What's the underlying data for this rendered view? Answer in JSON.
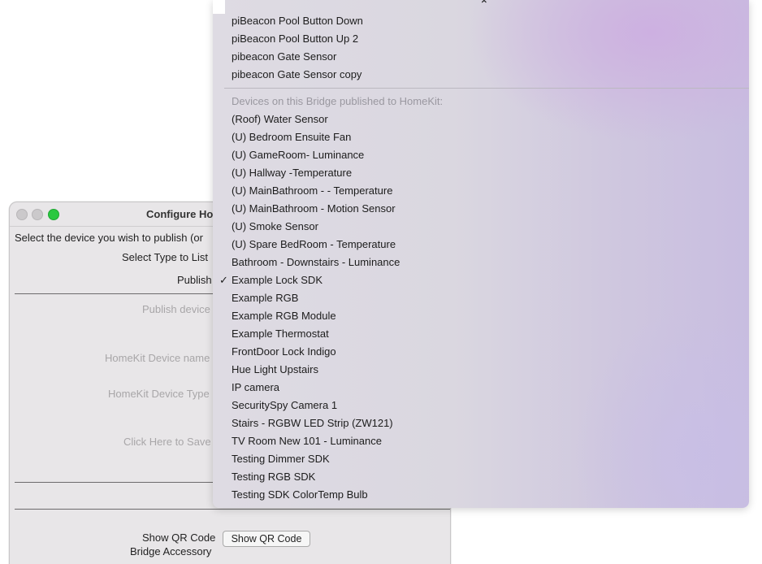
{
  "window": {
    "title": "Configure Ho",
    "instruction": "Select the device you wish to publish (or",
    "select_type_label": "Select Type to List",
    "publish_label": "Publish",
    "publish_device_label": "Publish device",
    "homekit_device_name_label": "HomeKit Device name",
    "homekit_device_type_label": "HomeKit Device Type",
    "click_save_label": "Click Here to Save",
    "show_qr_label": "Show QR Code",
    "show_qr_button": "Show QR Code",
    "bridge_accessory_label": "Bridge Accessory"
  },
  "menu": {
    "scroll_up_glyph": "⌃",
    "items_top": [
      "piBeacon Pool Button Down",
      "piBeacon Pool Button Up 2",
      "pibeacon Gate Sensor",
      "pibeacon Gate Sensor copy"
    ],
    "section_header": "Devices  on this Bridge published to HomeKit:",
    "items_bridge": [
      "(Roof) Water Sensor",
      "(U) Bedroom Ensuite Fan",
      "(U) GameRoom-  Luminance",
      "(U) Hallway -Temperature",
      "(U) MainBathroom - - Temperature",
      "(U) MainBathroom - Motion Sensor",
      "(U) Smoke Sensor",
      "(U) Spare BedRoom -  Temperature",
      "Bathroom - Downstairs - Luminance",
      "Example Lock SDK",
      "Example RGB",
      "Example RGB Module",
      "Example Thermostat",
      "FrontDoor Lock Indigo",
      "Hue Light Upstairs",
      "IP camera",
      "SecuritySpy Camera 1",
      "Stairs - RGBW LED Strip (ZW121)",
      "TV Room New 101 - Luminance",
      "Testing Dimmer SDK",
      "Testing RGB SDK",
      "Testing SDK ColorTemp Bulb"
    ],
    "checkmark": "✓",
    "checked_item": "Example Lock SDK"
  }
}
